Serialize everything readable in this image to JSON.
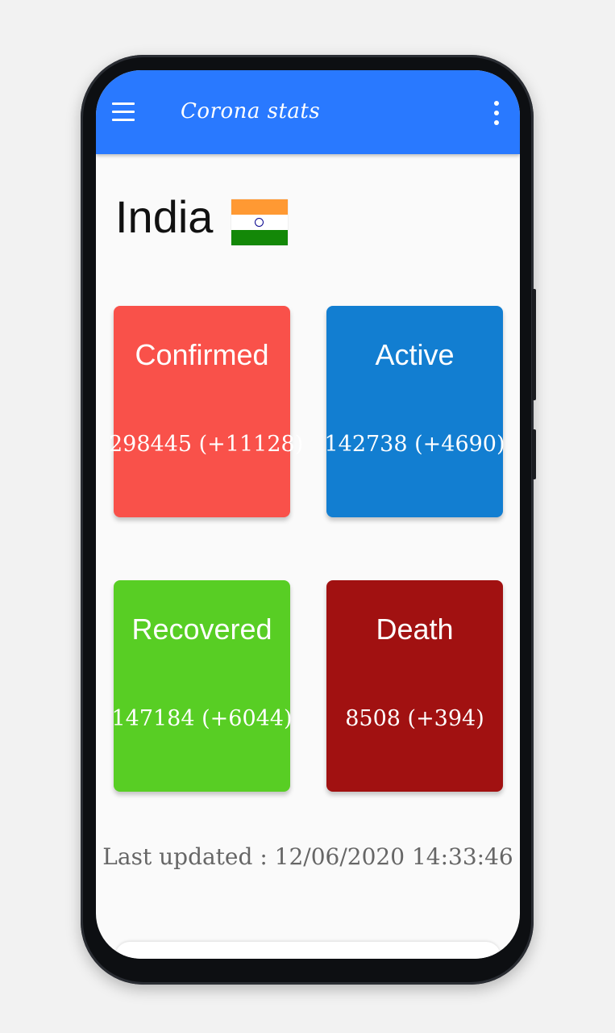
{
  "toolbar": {
    "title": "Corona stats",
    "color": "#2979ff",
    "menu_icon": "hamburger-menu-icon",
    "overflow_icon": "more-vertical-icon"
  },
  "country": {
    "name": "India",
    "flag_icon": "india-flag-icon",
    "flag_colors": {
      "top": "#FF9933",
      "middle": "#FFFFFF",
      "bottom": "#138808",
      "chakra": "#06038D"
    }
  },
  "stats": {
    "confirmed": {
      "label": "Confirmed",
      "value": "298445 (+11128)",
      "color": "#f9514a"
    },
    "active": {
      "label": "Active",
      "value": "142738 (+4690)",
      "color": "#127ed1"
    },
    "recovered": {
      "label": "Recovered",
      "value": "147184 (+6044)",
      "color": "#58ce24"
    },
    "death": {
      "label": "Death",
      "value": "8508 (+394)",
      "color": "#a11111"
    }
  },
  "last_updated": "Last updated : 12/06/2020 14:33:46"
}
